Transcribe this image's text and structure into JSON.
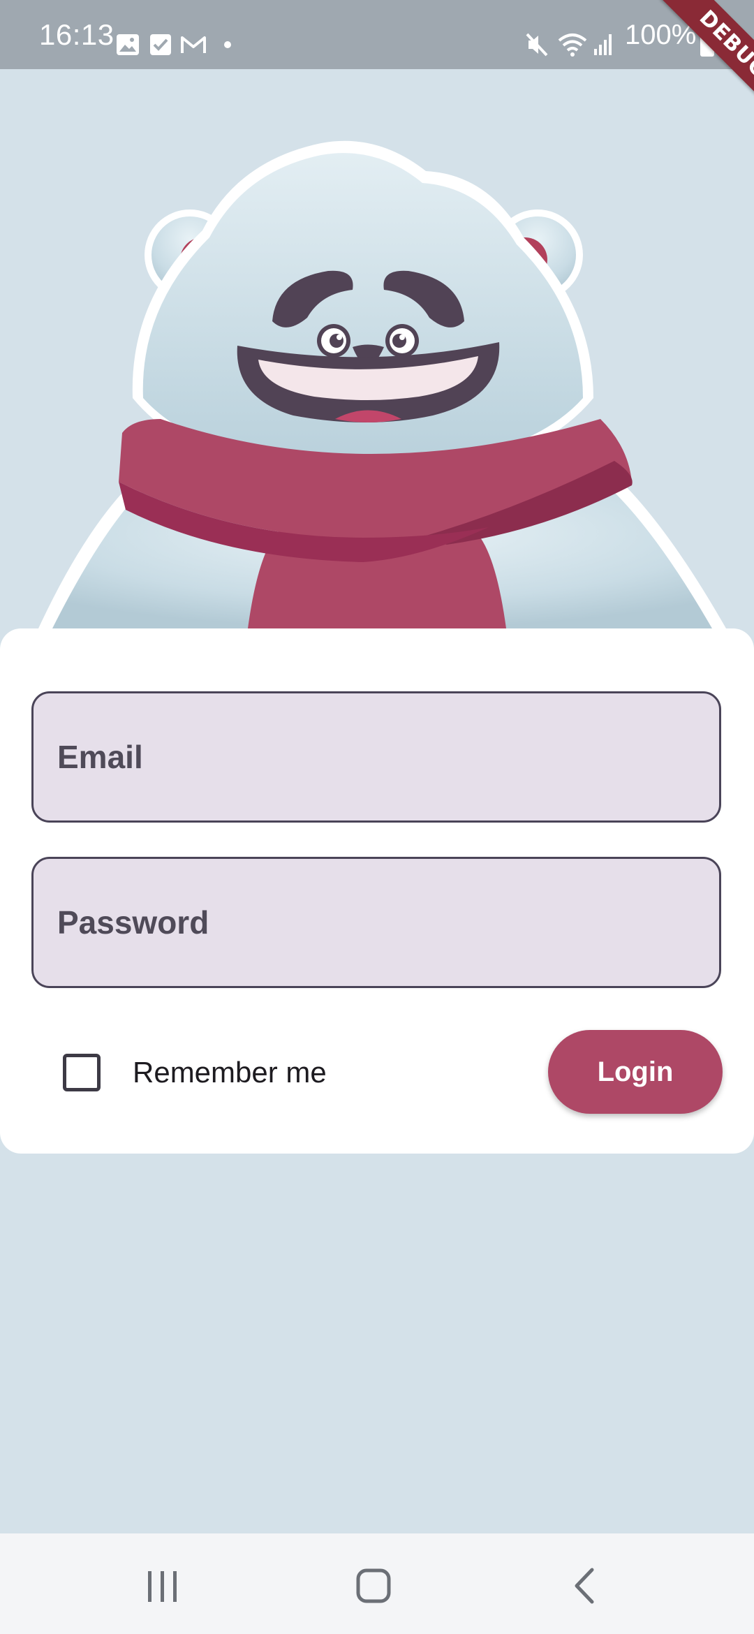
{
  "status_bar": {
    "time": "16:13",
    "battery": "100%",
    "left_icons": [
      "gallery-icon",
      "checkbox-notification-icon",
      "gmail-icon",
      "dot-icon"
    ],
    "right_icons": [
      "mute-icon",
      "wifi-icon",
      "signal-icon",
      "battery-icon"
    ]
  },
  "debug_banner": "DEBUG",
  "form": {
    "email_placeholder": "Email",
    "password_placeholder": "Password",
    "remember_label": "Remember me",
    "remember_checked": false,
    "login_label": "Login"
  },
  "nav": {
    "icons": [
      "recent-apps-icon",
      "home-icon",
      "back-icon"
    ]
  },
  "colors": {
    "background": "#d4e1e9",
    "accent": "#ae4866",
    "field_fill": "#e6dfea",
    "status_bar": "#9fa8b0"
  }
}
